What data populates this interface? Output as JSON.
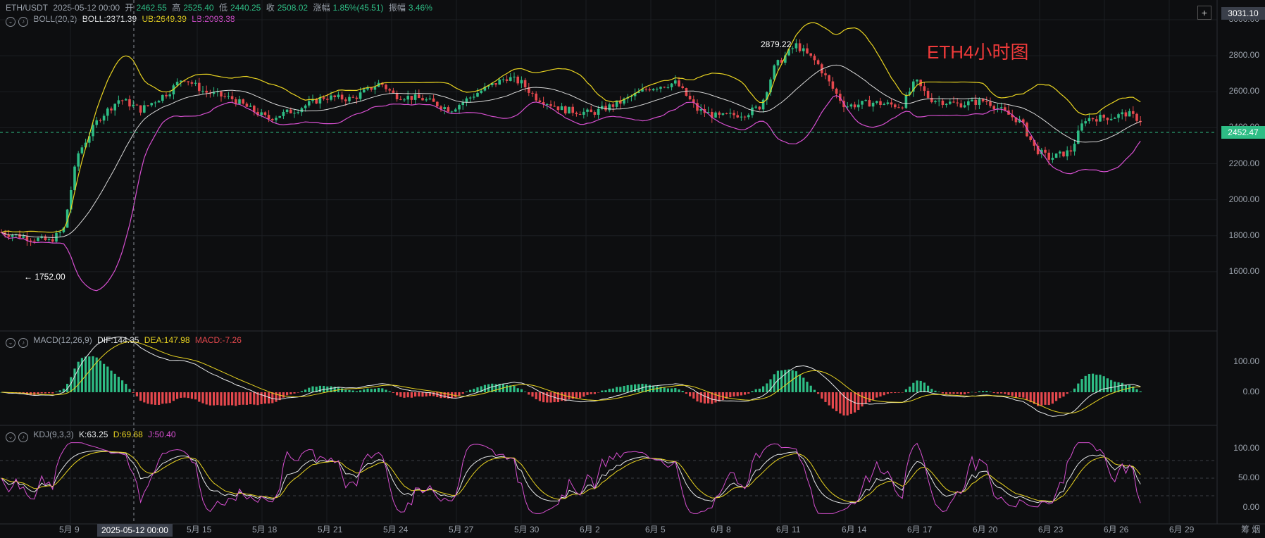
{
  "header": {
    "symbol": "ETH/USDT",
    "datetime": "2025-05-12 00:00",
    "open_label": "开",
    "open": "2462.55",
    "high_label": "高",
    "high": "2525.40",
    "low_label": "低",
    "low": "2440.25",
    "close_label": "收",
    "close": "2508.02",
    "change_label": "涨幅",
    "change": "1.85%(45.51)",
    "amp_label": "振幅",
    "amp": "3.46%"
  },
  "boll": {
    "name": "BOLL(20,2)",
    "mid": "BOLL:2371.39",
    "ub": "UB:2649.39",
    "lb": "LB:2093.38"
  },
  "macd": {
    "name": "MACD(12,26,9)",
    "dif": "DIF:144.35",
    "dea": "DEA:147.98",
    "macd": "MACD:-7.26"
  },
  "kdj": {
    "name": "KDJ(9,3,3)",
    "k": "K:63.25",
    "d": "D:69.68",
    "j": "J:50.40"
  },
  "title_text": "ETH4小时图",
  "annotations": {
    "high_mark": "2879.22",
    "low_mark": "← 1752.00"
  },
  "price_axis": [
    "3000.00",
    "2800.00",
    "2600.00",
    "2400.00",
    "2200.00",
    "2000.00",
    "1800.00",
    "1600.00"
  ],
  "price_tag_top": "3031.10",
  "current_price": "2452.47",
  "macd_axis": [
    "100.00",
    "0.00"
  ],
  "kdj_axis": [
    "100.00",
    "50.00",
    "0.00"
  ],
  "x_axis": [
    "5月 9",
    "5月 15",
    "5月 18",
    "5月 21",
    "5月 24",
    "5月 27",
    "5月 30",
    "6月 2",
    "6月 5",
    "6月 8",
    "6月 11",
    "6月 14",
    "6月 17",
    "6月 20",
    "6月 23",
    "6月 26",
    "6月 29"
  ],
  "crosshair_date": "2025-05-12 00:00",
  "corner_text": "筹 烟",
  "colors": {
    "up": "#2ebd85",
    "down": "#e5484d",
    "boll_ub": "#e8d321",
    "boll_lb": "#d64fd0",
    "boll_mid": "#d9d9d9",
    "bg": "#0d0e10",
    "current_price": "#2ebd85"
  }
}
